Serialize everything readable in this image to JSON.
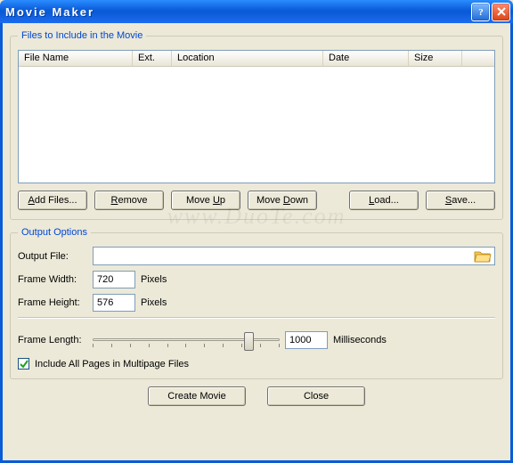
{
  "window": {
    "title": "Movie Maker"
  },
  "group_files": {
    "legend": "Files to Include in the Movie",
    "columns": {
      "filename": "File Name",
      "ext": "Ext.",
      "location": "Location",
      "date": "Date",
      "size": "Size"
    },
    "rows": []
  },
  "buttons": {
    "add_files_pre": "A",
    "add_files_post": "dd Files...",
    "remove_pre": "R",
    "remove_post": "emove",
    "move_up_pre": "Move ",
    "move_up_u": "U",
    "move_up_post": "p",
    "move_down_pre": "Move ",
    "move_down_u": "D",
    "move_down_post": "own",
    "load_pre": "L",
    "load_post": "oad...",
    "save_pre": "S",
    "save_post": "ave...",
    "create_movie": "Create Movie",
    "close": "Close"
  },
  "group_output": {
    "legend": "Output Options",
    "labels": {
      "output_file": "Output File:",
      "frame_width": "Frame Width:",
      "frame_height": "Frame Height:",
      "frame_length": "Frame Length:"
    },
    "values": {
      "output_file": "",
      "frame_width": "720",
      "frame_height": "576",
      "frame_length": "1000"
    },
    "units": {
      "pixels": "Pixels",
      "ms": "Milliseconds"
    },
    "checkbox": {
      "checked": true,
      "label": "Include All Pages in Multipage Files"
    }
  },
  "watermark": "www.DuoTe.com"
}
